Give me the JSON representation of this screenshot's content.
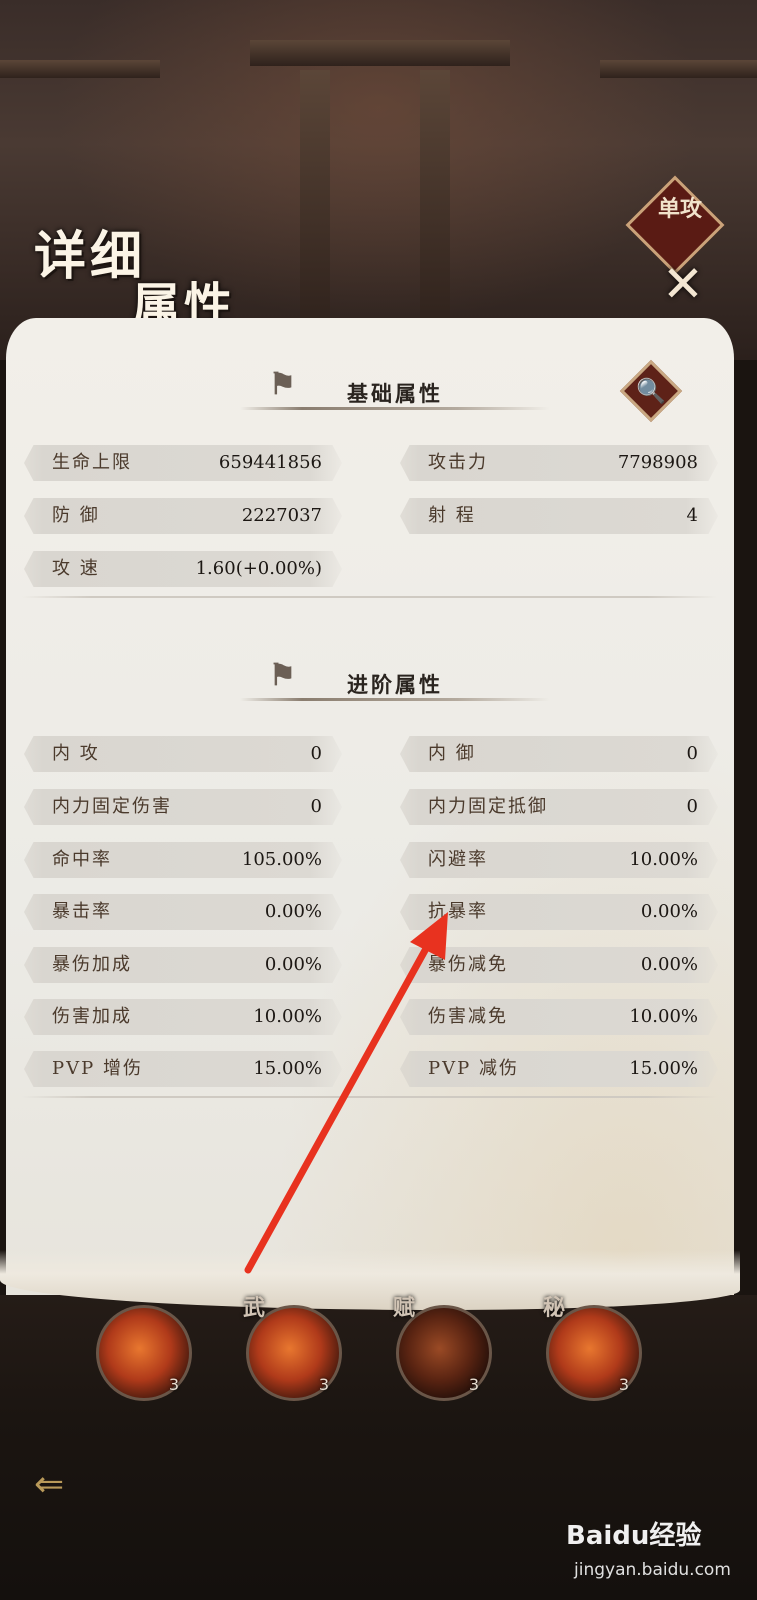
{
  "header": {
    "title_line1": "详细",
    "title_line2": "属性",
    "mode_badge": "单攻",
    "close_label": "✕"
  },
  "basic": {
    "section_title": "基础属性",
    "search_icon_glyph": "🔍",
    "stats": [
      {
        "name": "生命上限",
        "value": "659441856"
      },
      {
        "name": "攻击力",
        "value": "7798908"
      },
      {
        "name": "防  御",
        "value": "2227037"
      },
      {
        "name": "射  程",
        "value": "4"
      },
      {
        "name": "攻  速",
        "value": "1.60(+0.00%)"
      }
    ]
  },
  "advanced": {
    "section_title": "进阶属性",
    "stats": [
      {
        "name": "内  攻",
        "value": "0"
      },
      {
        "name": "内  御",
        "value": "0"
      },
      {
        "name": "内力固定伤害",
        "value": "0"
      },
      {
        "name": "内力固定抵御",
        "value": "0"
      },
      {
        "name": "命中率",
        "value": "105.00%"
      },
      {
        "name": "闪避率",
        "value": "10.00%"
      },
      {
        "name": "暴击率",
        "value": "0.00%"
      },
      {
        "name": "抗暴率",
        "value": "0.00%"
      },
      {
        "name": "暴伤加成",
        "value": "0.00%"
      },
      {
        "name": "暴伤减免",
        "value": "0.00%"
      },
      {
        "name": "伤害加成",
        "value": "10.00%"
      },
      {
        "name": "伤害减免",
        "value": "10.00%"
      },
      {
        "name": "PVP 增伤",
        "value": "15.00%"
      },
      {
        "name": "PVP 减伤",
        "value": "15.00%"
      }
    ]
  },
  "skills": [
    {
      "tag": "",
      "level": "3"
    },
    {
      "tag": "武",
      "level": "3"
    },
    {
      "tag": "赋",
      "level": "3"
    },
    {
      "tag": "秘",
      "level": "3"
    }
  ],
  "back_icon_glyph": "⇐",
  "watermark": {
    "brand": "Baidu经验",
    "url": "jingyan.baidu.com"
  },
  "colors": {
    "accent_red": "#e8321f",
    "panel": "#eceae4",
    "badge": "#5e2218"
  }
}
